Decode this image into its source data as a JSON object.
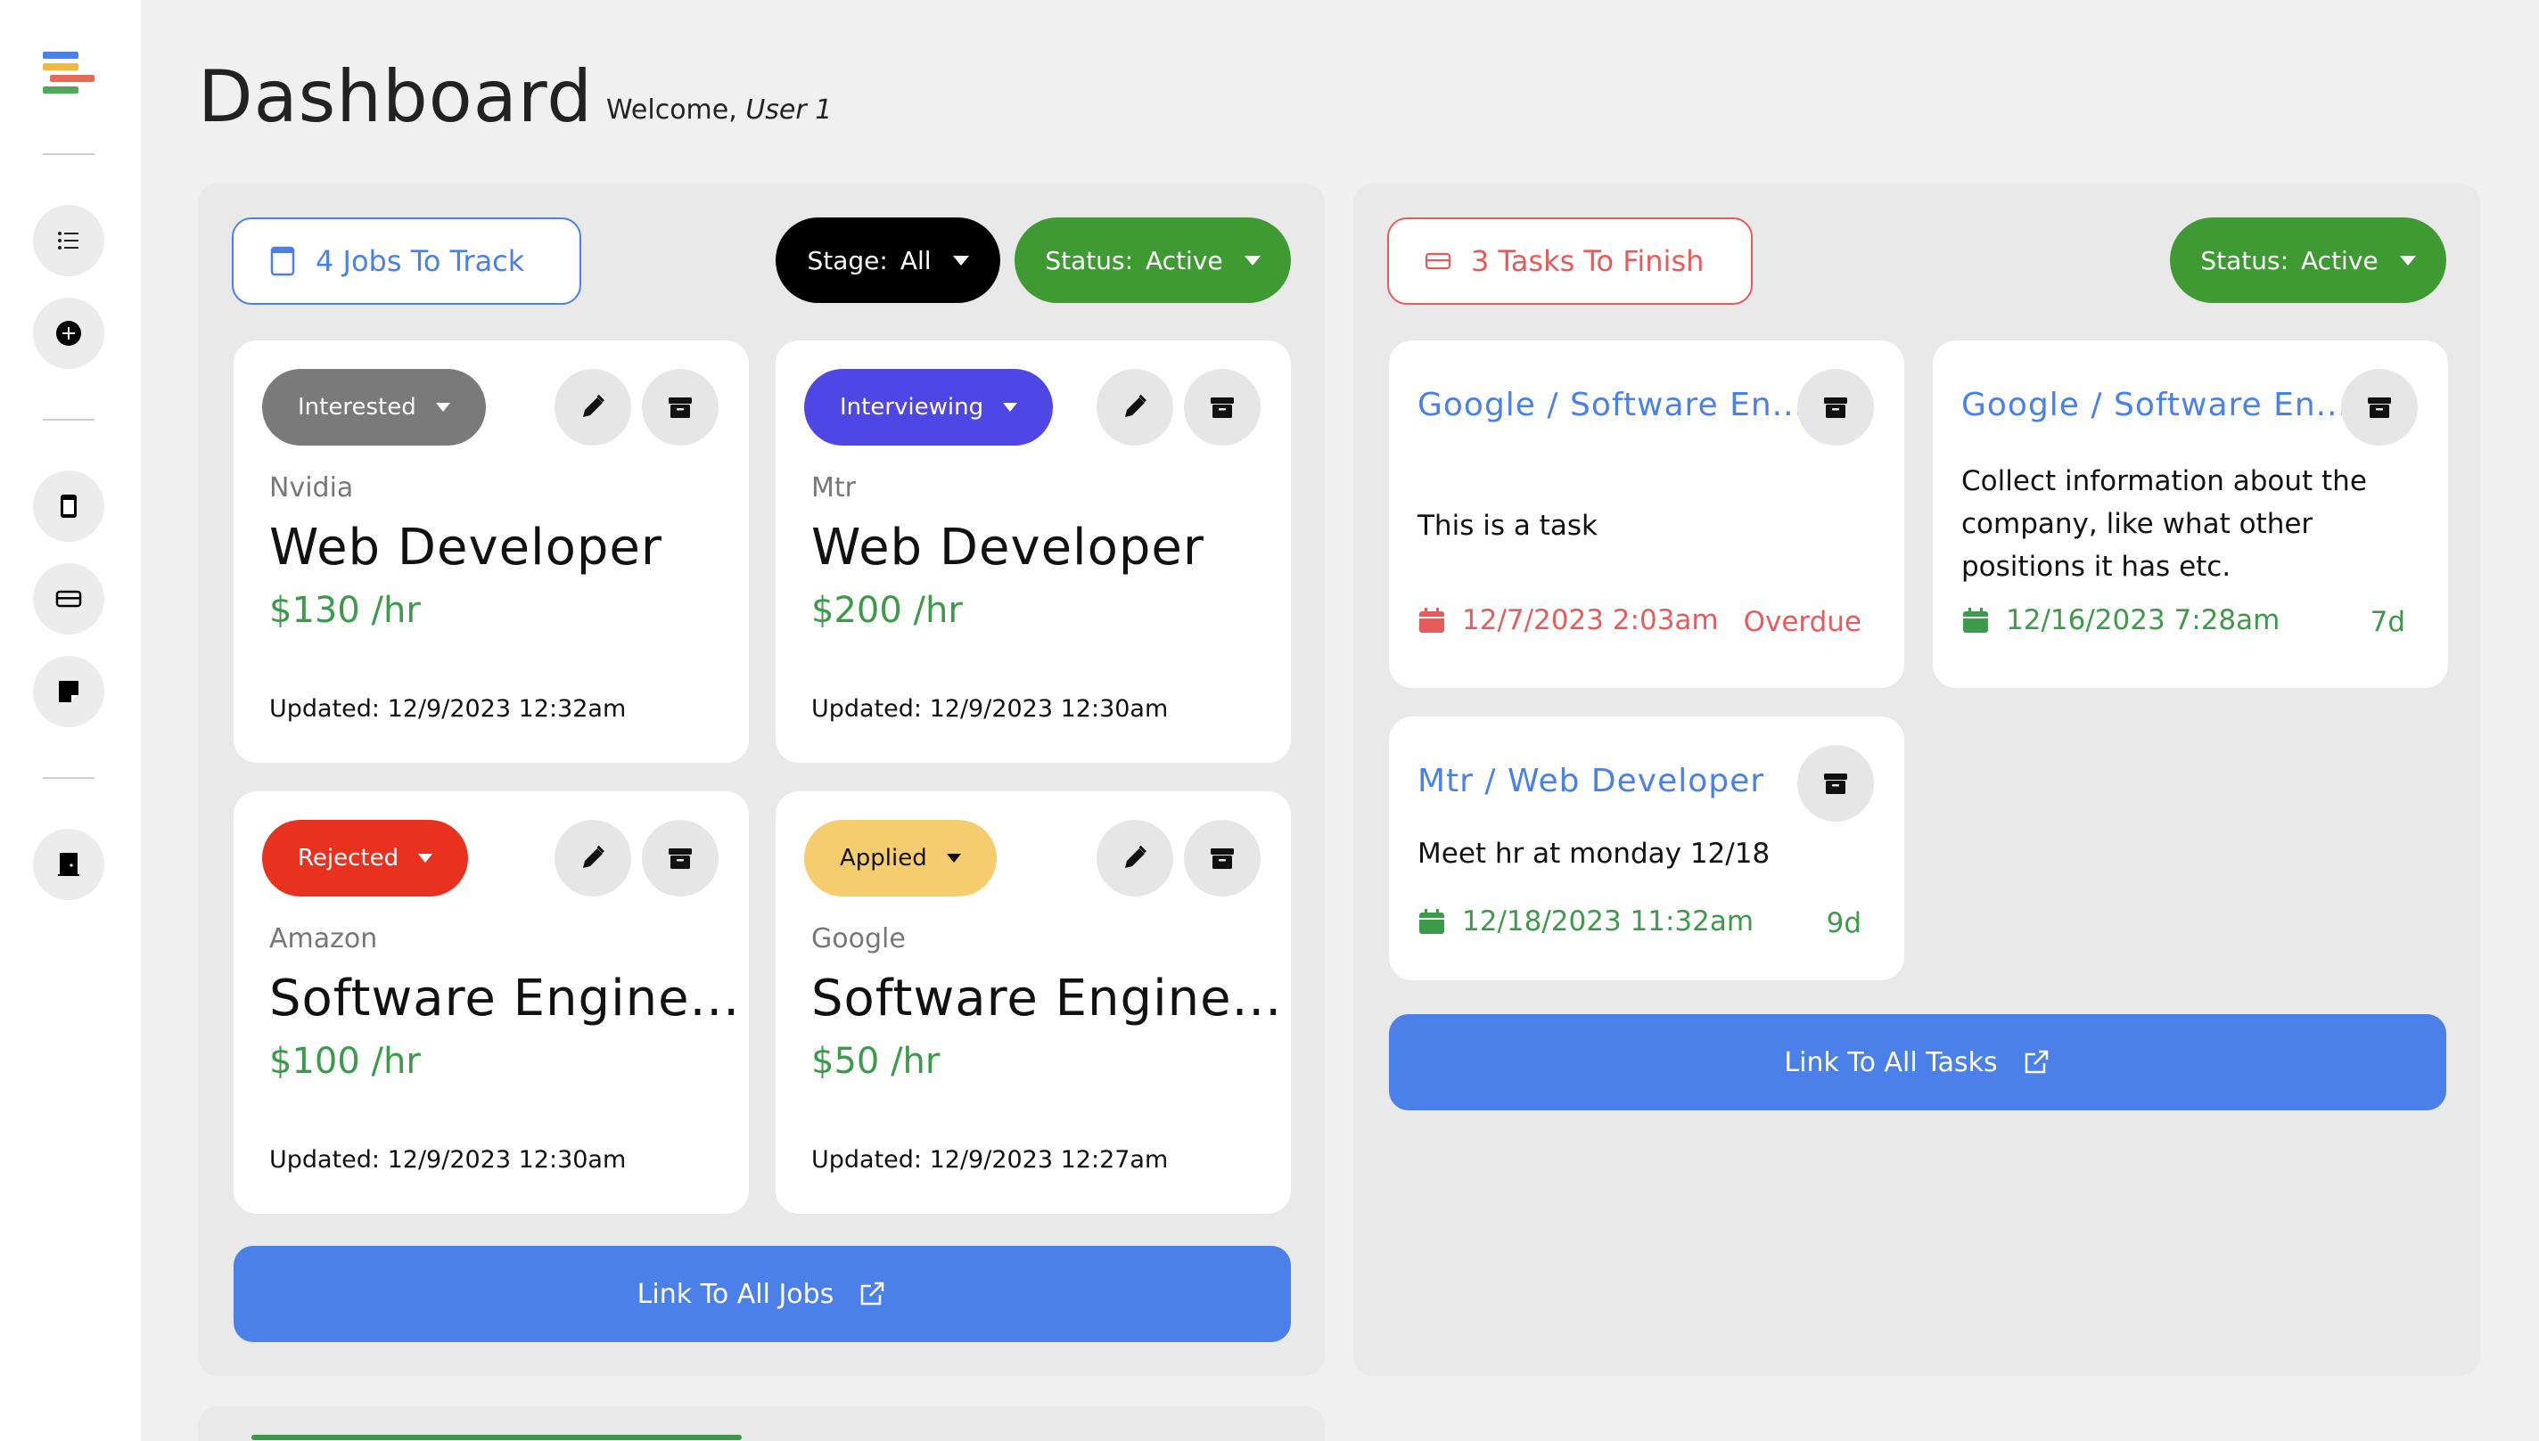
{
  "header": {
    "title": "Dashboard",
    "welcome_prefix": "Welcome,",
    "user": "User 1"
  },
  "sidebar": {
    "items": [
      {
        "icon": "list-icon"
      },
      {
        "icon": "add-circle-icon"
      },
      {
        "icon": "jobs-icon"
      },
      {
        "icon": "tasks-icon"
      },
      {
        "icon": "notes-icon"
      },
      {
        "icon": "logout-door-icon"
      }
    ]
  },
  "jobs": {
    "count_label": "4 Jobs To Track",
    "stage_filter": {
      "label": "Stage:",
      "value": "All"
    },
    "status_filter": {
      "label": "Status:",
      "value": "Active"
    },
    "cards": [
      {
        "stage": "Interested",
        "stage_color": "#7a7a7a",
        "company": "Nvidia",
        "title": "Web Developer",
        "pay": "$130 /hr",
        "updated": "Updated: 12/9/2023 12:32am"
      },
      {
        "stage": "Interviewing",
        "stage_color": "#4e46e5",
        "company": "Mtr",
        "title": "Web Developer",
        "pay": "$200 /hr",
        "updated": "Updated: 12/9/2023 12:30am"
      },
      {
        "stage": "Rejected",
        "stage_color": "#e8311f",
        "company": "Amazon",
        "title": "Software Engine...",
        "pay": "$100 /hr",
        "updated": "Updated: 12/9/2023 12:30am"
      },
      {
        "stage": "Applied",
        "stage_color": "#f6cd6e",
        "company": "Google",
        "title": "Software Engine...",
        "pay": "$50 /hr",
        "updated": "Updated: 12/9/2023 12:27am"
      }
    ],
    "link_label": "Link To All Jobs"
  },
  "tasks": {
    "count_label": "3 Tasks To Finish",
    "status_filter": {
      "label": "Status:",
      "value": "Active"
    },
    "cards": [
      {
        "heading": "Google / Software En...",
        "body": "This is a task",
        "date": "12/7/2023 2:03am",
        "status": "Overdue",
        "tone": "red"
      },
      {
        "heading": "Google / Software En...",
        "body": "Collect information about the company, like what other positions it has etc.",
        "date": "12/16/2023 7:28am",
        "status": "7d",
        "tone": "green"
      },
      {
        "heading": "Mtr / Web Developer",
        "body": "Meet hr at monday 12/18",
        "date": "12/18/2023 11:32am",
        "status": "9d",
        "tone": "green"
      }
    ],
    "link_label": "Link To All Tasks"
  },
  "colors": {
    "accent_blue": "#4a80e8",
    "active_green": "#3f9a34",
    "overdue_red": "#e65c5c"
  }
}
